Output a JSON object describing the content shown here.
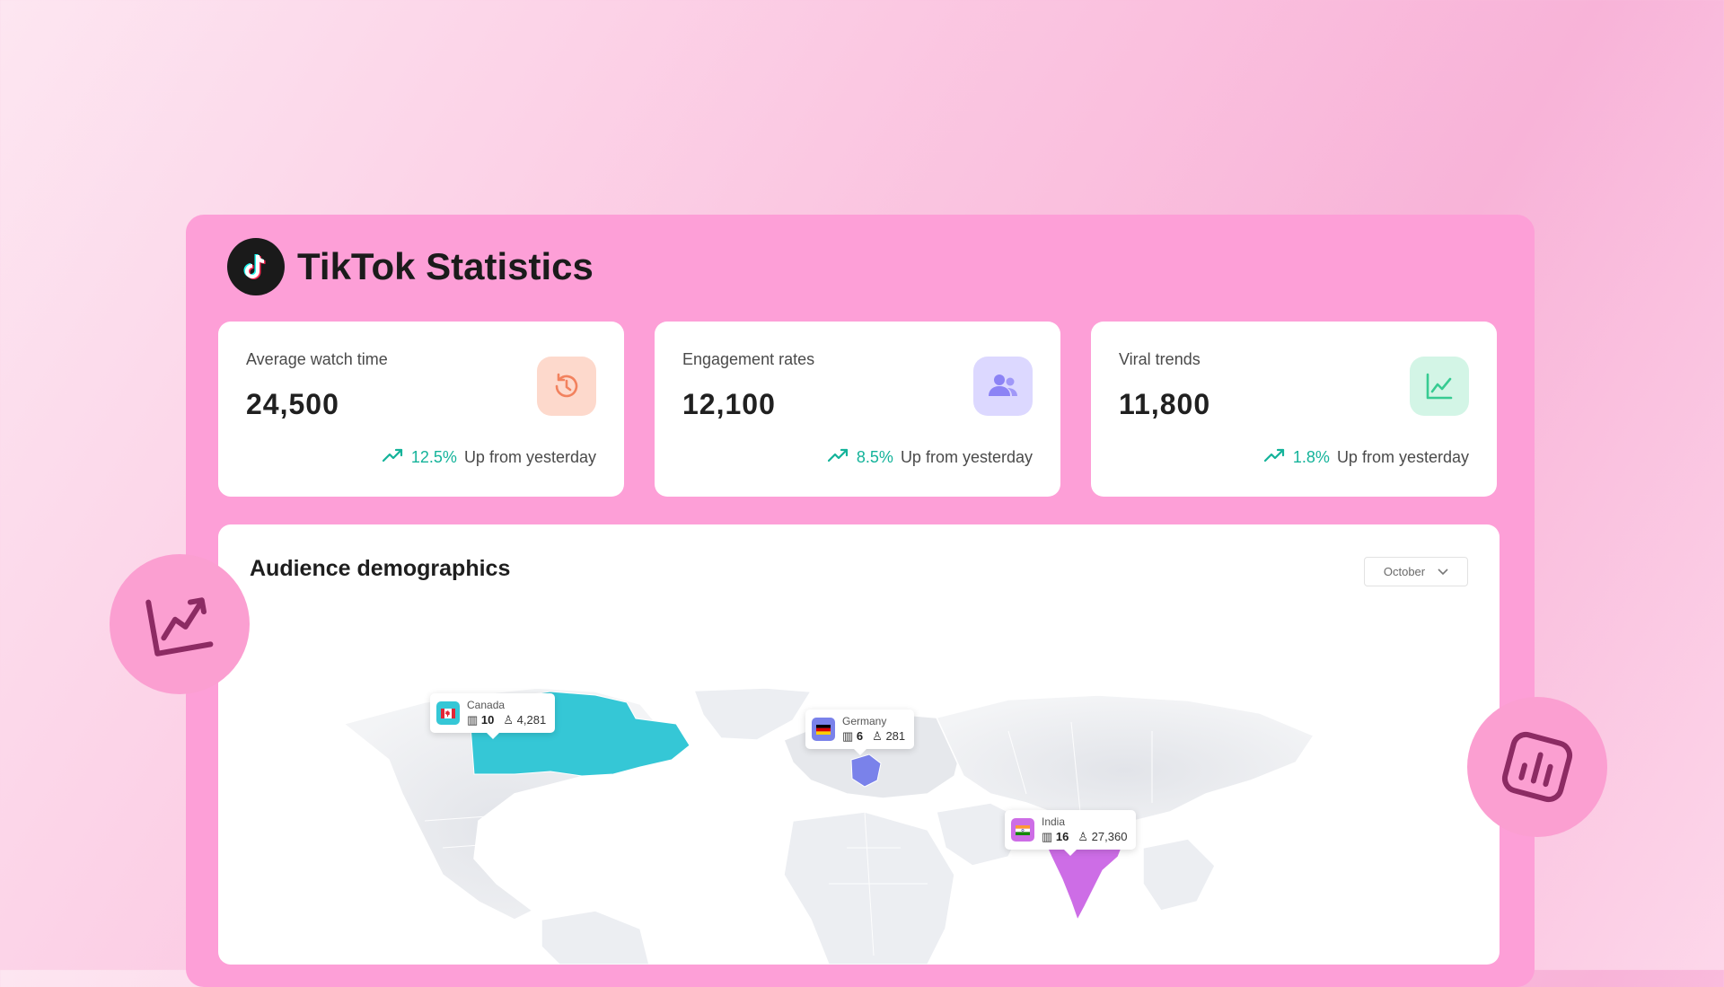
{
  "header": {
    "title": "TikTok Statistics",
    "logo_icon": "tiktok-icon"
  },
  "cards": [
    {
      "label": "Average watch time",
      "value": "24,500",
      "pct": "12.5%",
      "trend_text": "Up from yesterday",
      "icon": "history-icon",
      "icon_bg": "#fdd9cc",
      "icon_color": "#f2825e"
    },
    {
      "label": "Engagement rates",
      "value": "12,100",
      "pct": "8.5%",
      "trend_text": "Up from yesterday",
      "icon": "users-icon",
      "icon_bg": "#dcd8ff",
      "icon_color": "#8c83f5"
    },
    {
      "label": "Viral trends",
      "value": "11,800",
      "pct": "1.8%",
      "trend_text": "Up from yesterday",
      "icon": "line-chart-icon",
      "icon_bg": "#d3f5e6",
      "icon_color": "#37cb92"
    }
  ],
  "demographics": {
    "title": "Audience demographics",
    "month": "October",
    "tooltips": [
      {
        "country": "Canada",
        "buildings": "10",
        "people": "4,281",
        "color": "#35c7d6"
      },
      {
        "country": "Germany",
        "buildings": "6",
        "people": "281",
        "color": "#7a82ea"
      },
      {
        "country": "India",
        "buildings": "16",
        "people": "27,360",
        "color": "#cd6de6"
      }
    ]
  },
  "colors": {
    "accent": "#fd9fd7",
    "trend_green": "#14b39a"
  },
  "decor": {
    "left_icon": "trending-up-icon",
    "right_icon": "bar-chart-icon"
  }
}
